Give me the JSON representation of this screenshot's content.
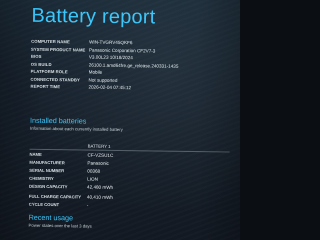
{
  "report": {
    "title": "Battery report"
  },
  "system_info": [
    {
      "label": "COMPUTER NAME",
      "value": "WIN-TVGRV45QKF6"
    },
    {
      "label": "SYSTEM PRODUCT NAME",
      "value": "Panasonic Corporation CF2V7-3"
    },
    {
      "label": "BIOS",
      "value": "V3.00L23 10/18/2024"
    },
    {
      "label": "OS BUILD",
      "value": "26100.1.amd64fre.ge_release.240331-1435"
    },
    {
      "label": "PLATFORM ROLE",
      "value": "Mobile"
    },
    {
      "label": "CONNECTED STANDBY",
      "value": "Not supported"
    },
    {
      "label": "REPORT TIME",
      "value": "2026-02-04  07:45:12"
    }
  ],
  "installed_batteries": {
    "title": "Installed batteries",
    "subtitle": "Information about each currently installed battery",
    "battery_header": "BATTERY 1",
    "rows": [
      {
        "label": "NAME",
        "value": "CF-VZSU1C"
      },
      {
        "label": "MANUFACTURER",
        "value": "Panasonic"
      },
      {
        "label": "SERIAL NUMBER",
        "value": "00368"
      },
      {
        "label": "CHEMISTRY",
        "value": "LION"
      },
      {
        "label": "DESIGN CAPACITY",
        "value": "42,480 mWh"
      },
      {
        "label": "FULL CHARGE CAPACITY",
        "value": "40,410 mWh"
      },
      {
        "label": "CYCLE COUNT",
        "value": "-"
      }
    ]
  },
  "recent_usage": {
    "title": "Recent usage",
    "subtitle": "Power states over the last 3 days"
  },
  "colors": {
    "accent": "#38c9ff",
    "background": "#17222e",
    "text": "#eef3f5"
  }
}
